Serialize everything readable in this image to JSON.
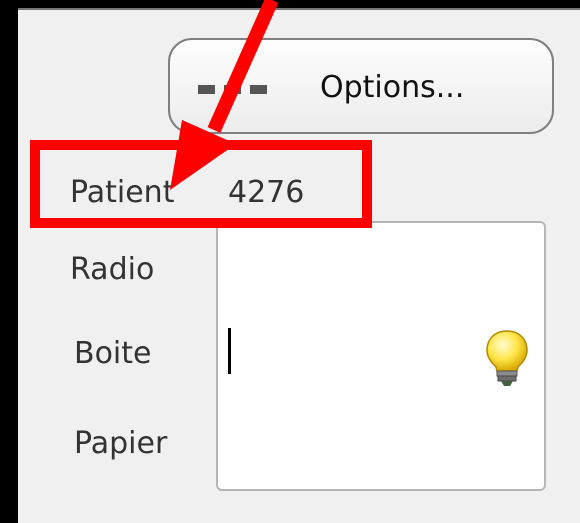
{
  "toolbar": {
    "options_label": "Options...",
    "options_icon": "more-dots-icon"
  },
  "form": {
    "patient_label": "Patient",
    "patient_value": "4276",
    "radio_label": "Radio",
    "boite_label": "Boite",
    "papier_label": "Papier",
    "notes_value": ""
  },
  "icons": {
    "hint": "lightbulb-icon"
  },
  "annotation": {
    "highlight_color": "#ff0000",
    "arrow_color": "#ff0000"
  }
}
